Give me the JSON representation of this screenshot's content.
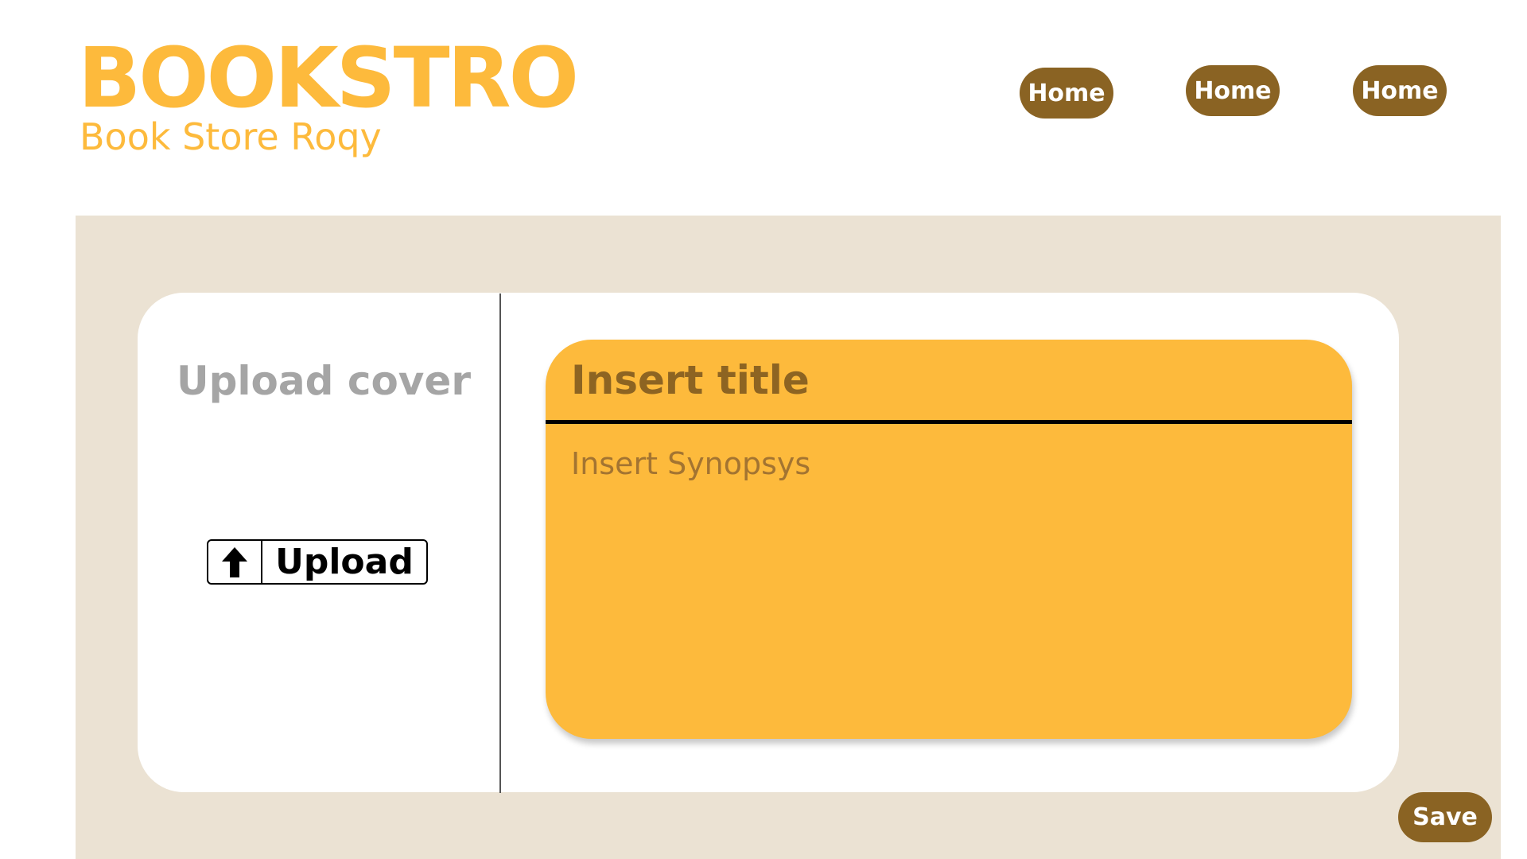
{
  "header": {
    "brand_title": "BOOKSTRO",
    "brand_subtitle": "Book Store Roqy",
    "nav": [
      {
        "label": "Home"
      },
      {
        "label": "Home"
      },
      {
        "label": "Home"
      }
    ]
  },
  "cover": {
    "heading": "Upload cover",
    "upload_button_label": "Upload",
    "upload_icon": "arrow-up-icon"
  },
  "form": {
    "title_placeholder": "Insert title",
    "title_value": "",
    "synopsis_placeholder": "Insert Synopsys",
    "synopsis_value": ""
  },
  "actions": {
    "save_label": "Save"
  },
  "colors": {
    "brand": "#fdba3c",
    "button": "#8a6323",
    "editor_background": "#ebe2d3",
    "form_text": "#8d6422"
  }
}
